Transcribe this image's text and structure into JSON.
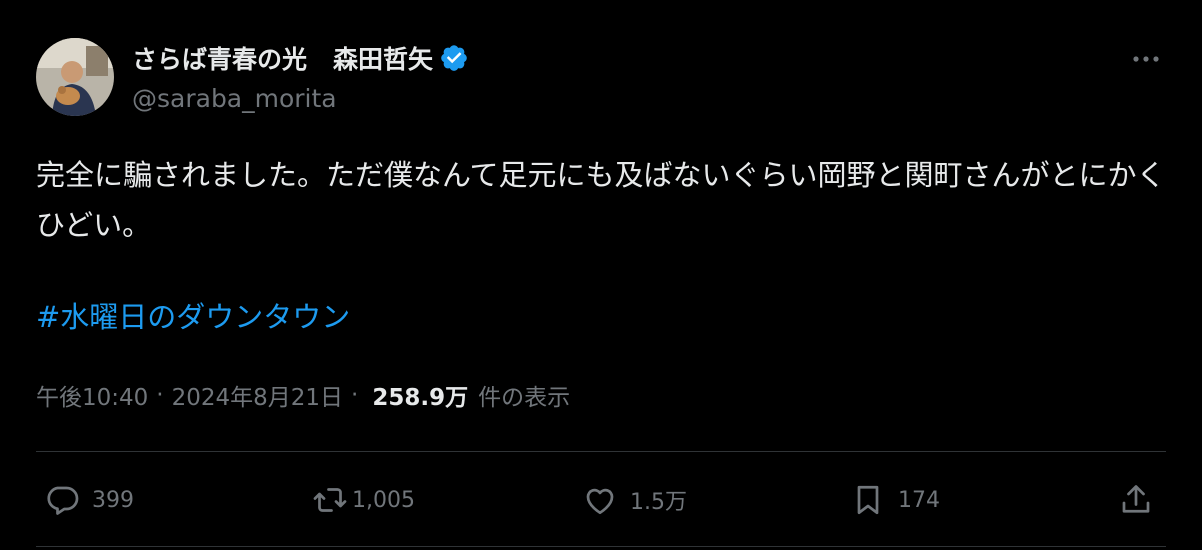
{
  "author": {
    "display_name_part1": "さらば青春の光",
    "display_name_part2": "森田哲矢",
    "handle": "@saraba_morita"
  },
  "tweet": {
    "text": "完全に騙されました。ただ僕なんて足元にも及ばないぐらい岡野と関町さんがとにかくひどい。",
    "hashtag": "#水曜日のダウンタウン"
  },
  "meta": {
    "time": "午後10:40",
    "separator": "·",
    "date": "2024年8月21日",
    "views_count": "258.9万",
    "views_label": "件の表示"
  },
  "actions": {
    "replies": "399",
    "retweets": "1,005",
    "likes": "1.5万",
    "bookmarks": "174"
  },
  "colors": {
    "background": "#000000",
    "text": "#e7e9ea",
    "muted": "#71767b",
    "link": "#1d9bf0",
    "verified": "#1d9bf0",
    "divider": "#2f3336"
  },
  "icons": [
    "avatar",
    "verified-badge-icon",
    "more-icon",
    "reply-icon",
    "retweet-icon",
    "like-icon",
    "bookmark-icon",
    "share-icon"
  ]
}
